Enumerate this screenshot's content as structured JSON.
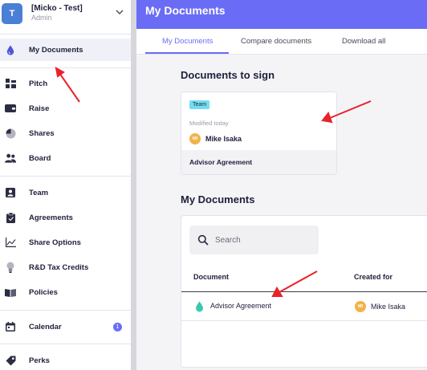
{
  "account": {
    "initial": "T",
    "name": "[Micko - Test]",
    "role": "Admin"
  },
  "sidebar": {
    "items": [
      {
        "label": "My Documents",
        "icon": "drop-icon"
      },
      {
        "label": "Pitch",
        "icon": "pitch-icon"
      },
      {
        "label": "Raise",
        "icon": "wallet-icon"
      },
      {
        "label": "Shares",
        "icon": "pie-chart-icon"
      },
      {
        "label": "Board",
        "icon": "people-icon"
      },
      {
        "label": "Team",
        "icon": "team-icon"
      },
      {
        "label": "Agreements",
        "icon": "clipboard-icon"
      },
      {
        "label": "Share Options",
        "icon": "line-chart-icon"
      },
      {
        "label": "R&D Tax Credits",
        "icon": "bulb-icon"
      },
      {
        "label": "Policies",
        "icon": "book-icon"
      },
      {
        "label": "Calendar",
        "icon": "calendar-icon",
        "badge": "1"
      },
      {
        "label": "Perks",
        "icon": "tag-icon"
      }
    ]
  },
  "header": {
    "title": "My Documents"
  },
  "tabs": [
    {
      "label": "My Documents",
      "active": true
    },
    {
      "label": "Compare documents",
      "active": false
    },
    {
      "label": "Download all",
      "active": false
    }
  ],
  "sign_section": {
    "title": "Documents to sign",
    "card": {
      "tag": "Team",
      "modified": "Modified today",
      "person_initials": "MI",
      "person_name": "Mike Isaka",
      "document": "Advisor Agreement"
    }
  },
  "documents_section": {
    "title": "My Documents",
    "search": {
      "placeholder": "Search",
      "value": ""
    },
    "columns": [
      "Document",
      "Created for"
    ],
    "rows": [
      {
        "document": "Advisor Agreement",
        "person_initials": "MI",
        "person_name": "Mike Isaka"
      }
    ]
  },
  "colors": {
    "accent": "#6a6cf5",
    "tag": "#74dcf2",
    "avatar": "#f2b24a",
    "document_icon": "#3cc7b0",
    "annotation_arrow": "#e8232a"
  }
}
